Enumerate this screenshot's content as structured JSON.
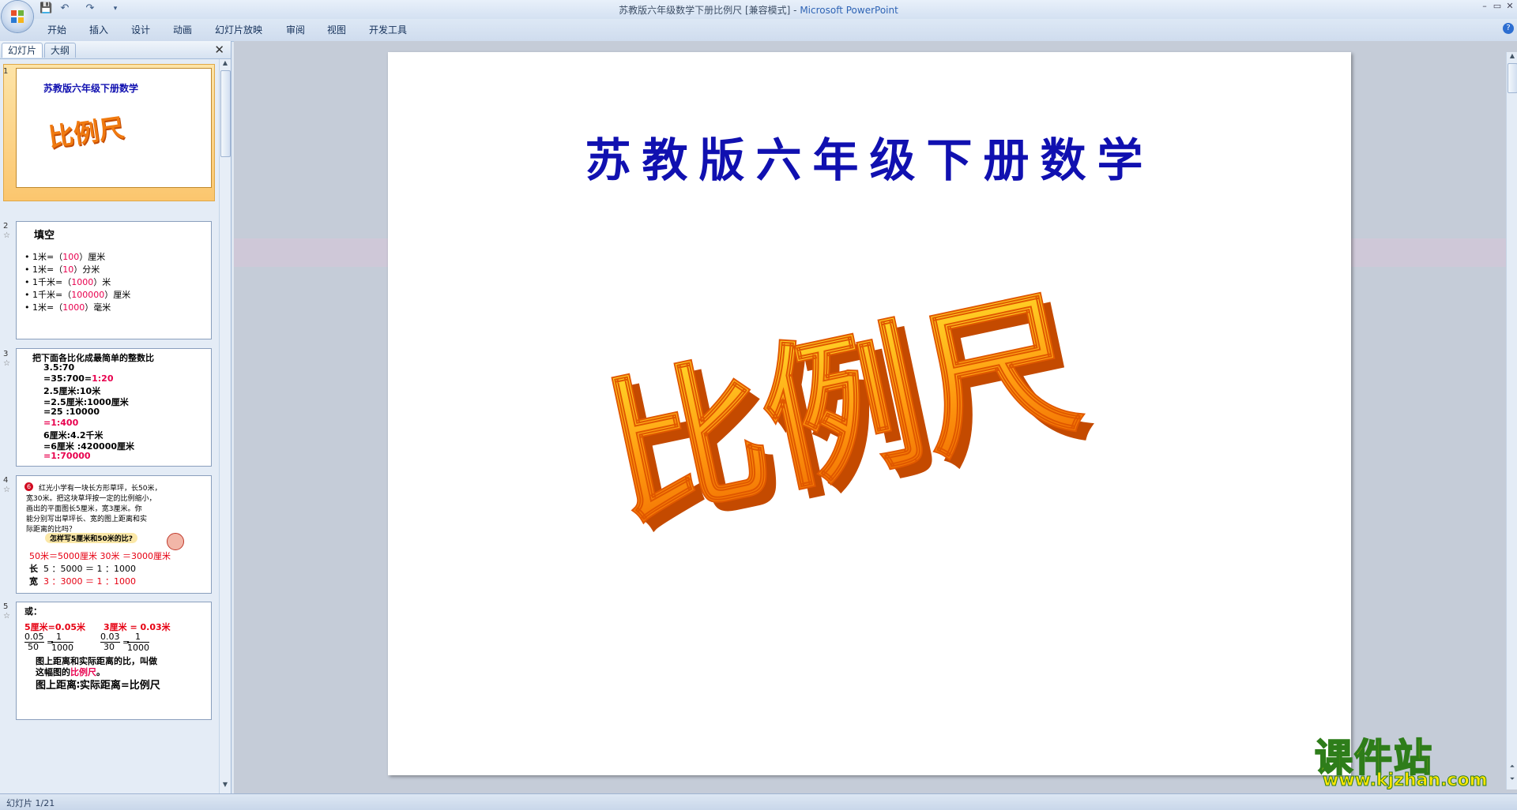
{
  "window": {
    "title": "苏教版六年级数学下册比例尺 [兼容模式]",
    "title_sep": " - ",
    "app_name": "Microsoft PowerPoint",
    "controls": {
      "minimize": "–",
      "maximize": "▭",
      "close": "✕"
    }
  },
  "quick_access": {
    "save": "💾",
    "undo": "↶",
    "redo": "↷",
    "more": "▾"
  },
  "ribbon": {
    "tabs": [
      "开始",
      "插入",
      "设计",
      "动画",
      "幻灯片放映",
      "审阅",
      "视图",
      "开发工具"
    ],
    "help": "?"
  },
  "pane": {
    "tabs": [
      "幻灯片",
      "大纲"
    ],
    "close": "✕"
  },
  "thumbnails": [
    {
      "num": "1",
      "title": "苏教版六年级下册数学",
      "art": "比例尺"
    },
    {
      "num": "2",
      "star": "☆",
      "heading": "填空",
      "lines": [
        {
          "pre": "• 1米=（",
          "val": "100",
          "post": "）厘米"
        },
        {
          "pre": "• 1米=（",
          "val": "10",
          "post": "）分米"
        },
        {
          "pre": "• 1千米=（",
          "val": "1000",
          "post": "）米"
        },
        {
          "pre": "• 1千米=（",
          "val": "100000",
          "post": "）厘米"
        },
        {
          "pre": "• 1米=（",
          "val": "1000",
          "post": "）毫米"
        }
      ]
    },
    {
      "num": "3",
      "star": "☆",
      "heading": "把下面各比化成最简单的整数比",
      "l1": "3.5:70",
      "l2a": "=35:700=",
      "l2b": "1:20",
      "l3": "2.5厘米:10米",
      "l4": "=2.5厘米:1000厘米",
      "l5": "=25 :10000",
      "l6": "=1:400",
      "l7": "6厘米:4.2千米",
      "l8": "=6厘米 :420000厘米",
      "l9": "=1:70000"
    },
    {
      "num": "4",
      "star": "☆",
      "badge": "6",
      "text1": "红光小学有一块长方形草坪，长50米，",
      "text2": "宽30米。把这块草坪按一定的比例缩小，",
      "text3": "画出的平面图长5厘米，宽3厘米。你",
      "text4": "能分别写出草坪长、宽的图上距离和实",
      "text5": "际距离的比吗？",
      "bubble": "怎样写5厘米和50米的比?",
      "conv": "50米＝5000厘米    30米 ＝3000厘米",
      "len_label": "长",
      "len": "5 ：5000 ＝ 1 ：1000",
      "wid_label": "宽",
      "wid_red": "3 ：3000",
      "wid_rest": "＝ 1 ：1000"
    },
    {
      "num": "5",
      "star": "☆",
      "or": "或：",
      "a": "5厘米=0.05米",
      "b": "3厘米 = 0.03米",
      "f1n": "0.05",
      "f1d": "50",
      "f2n": "1",
      "f2d": "1000",
      "f3n": "0.03",
      "f3d": "30",
      "f4n": "1",
      "f4d": "1000",
      "eq": "=",
      "def1": "图上距离和实际距离的比，叫做",
      "def2a": "这幅图的",
      "def2b": "比例尺",
      "def2c": "。",
      "def3": "图上距离∶实际距离=比例尺"
    }
  ],
  "slide": {
    "title": "苏教版六年级下册数学",
    "wordart": "比例尺"
  },
  "status": {
    "text": "幻灯片 1/21"
  },
  "watermark": {
    "cn": "课件站",
    "url": "www.kjzhan.com"
  }
}
